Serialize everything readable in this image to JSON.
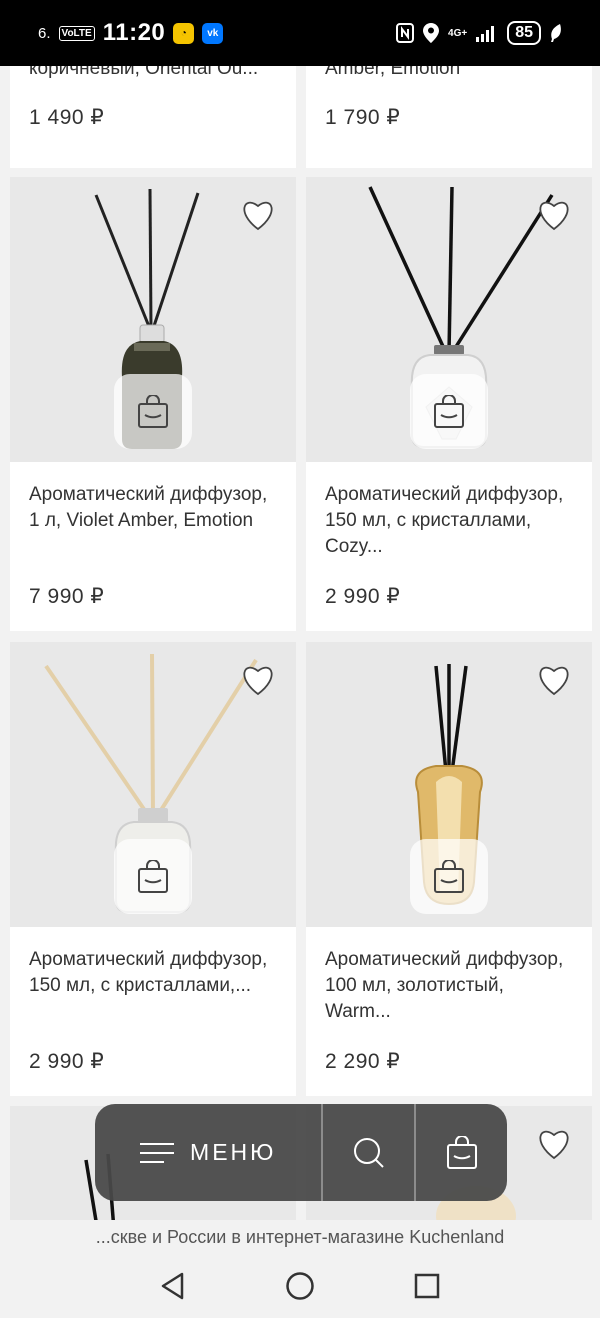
{
  "status_bar": {
    "indicator": "6.",
    "volte": "VoLTE",
    "time": "11:20",
    "app1": "◔",
    "app2": "vk",
    "network": "4G+",
    "battery": "85"
  },
  "products": [
    {
      "title": "Диффузор, коричневый, Oriental Ou...",
      "title_visible": "коричневый, Oriental Ou...",
      "price": "1 490 ₽",
      "icon": "heart-outline-icon"
    },
    {
      "title": "Диффузор, Amber, Emotion",
      "title_visible": "Amber, Emotion",
      "price": "1 790 ₽",
      "icon": "heart-outline-icon"
    },
    {
      "title": "Ароматический диффузор, 1 л, Violet Amber, Emotion",
      "price": "7 990 ₽",
      "icon": "heart-outline-icon"
    },
    {
      "title": "Ароматический диффузор, 150 мл, с кристаллами, Cozy...",
      "price": "2 990 ₽",
      "icon": "heart-outline-icon"
    },
    {
      "title": "Ароматический диффузор, 150 мл, с кристаллами,...",
      "price": "2 990 ₽",
      "icon": "heart-outline-icon"
    },
    {
      "title": "Ароматический диффузор, 100 мл, золотистый, Warm...",
      "price": "2 290 ₽",
      "icon": "heart-outline-icon"
    }
  ],
  "floating_bar": {
    "menu_label": "МЕНЮ",
    "menu_icon": "hamburger-icon",
    "search_icon": "search-icon",
    "cart_icon": "shopping-bag-icon"
  },
  "bottom_text": "...скве и России в интернет-магазине Kuchenland",
  "android_nav": {
    "back": "back-triangle-icon",
    "home": "home-circle-icon",
    "recents": "recents-square-icon"
  }
}
